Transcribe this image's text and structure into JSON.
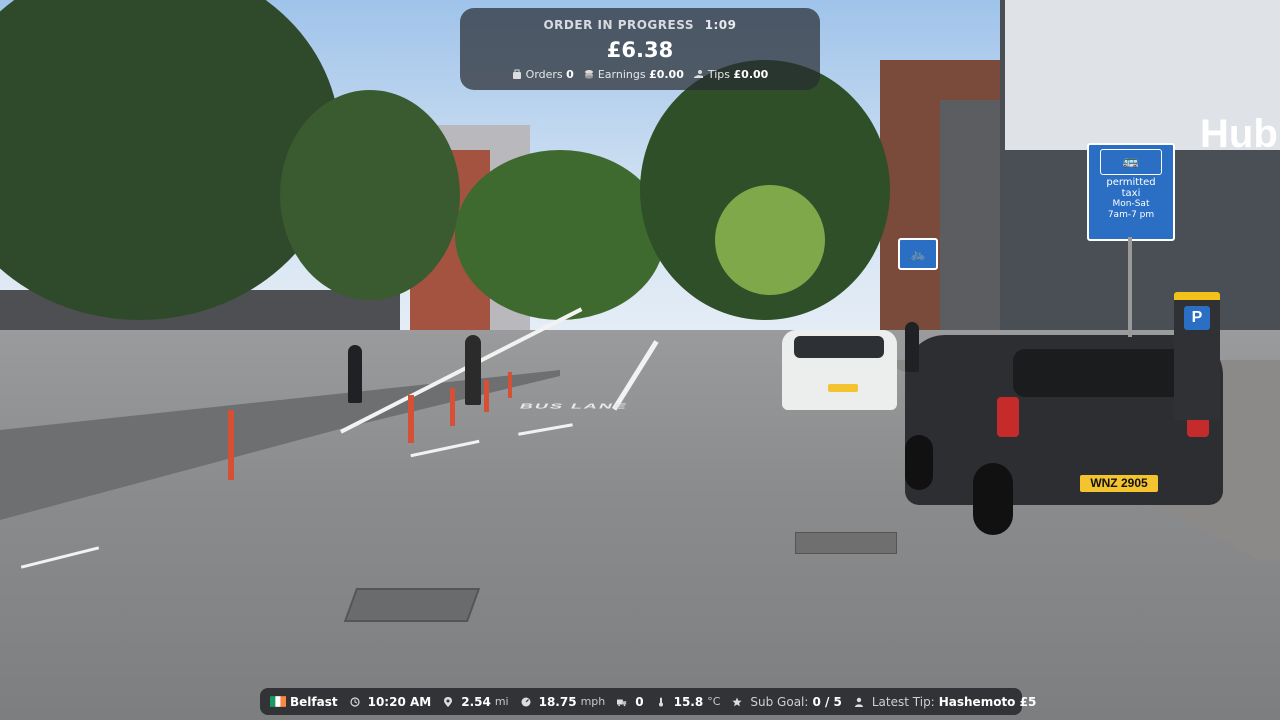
{
  "order_hud": {
    "status": "ORDER IN PROGRESS",
    "timer": "1:09",
    "amount": "£6.38",
    "orders_label": "Orders",
    "orders_value": "0",
    "earnings_label": "Earnings",
    "earnings_value": "£0.00",
    "tips_label": "Tips",
    "tips_value": "£0.00"
  },
  "status_bar": {
    "city": "Belfast",
    "time": "10:20 AM",
    "distance_value": "2.54",
    "distance_unit": "mi",
    "speed_value": "18.75",
    "speed_unit": "mph",
    "deliveries_value": "0",
    "temperature_value": "15.8",
    "temperature_unit": "°C",
    "sub_goal_label": "Sub Goal:",
    "sub_goal_value": "0 / 5",
    "latest_tip_label": "Latest Tip:",
    "latest_tip_value": "Hashemoto £5"
  },
  "scene_text": {
    "road_marking": "BUS LANE",
    "taxi_sign_line1": "permitted",
    "taxi_sign_line2": "taxi",
    "taxi_sign_line3": "Mon-Sat",
    "taxi_sign_line4": "7am-7 pm",
    "store_sign": "Hub",
    "parking_sign": "P",
    "plate_black_car": "WNZ 2905"
  },
  "colors": {
    "hud_bg": "#282c32",
    "sign_blue": "#2a6fc4",
    "plate_yellow": "#f4c430"
  }
}
